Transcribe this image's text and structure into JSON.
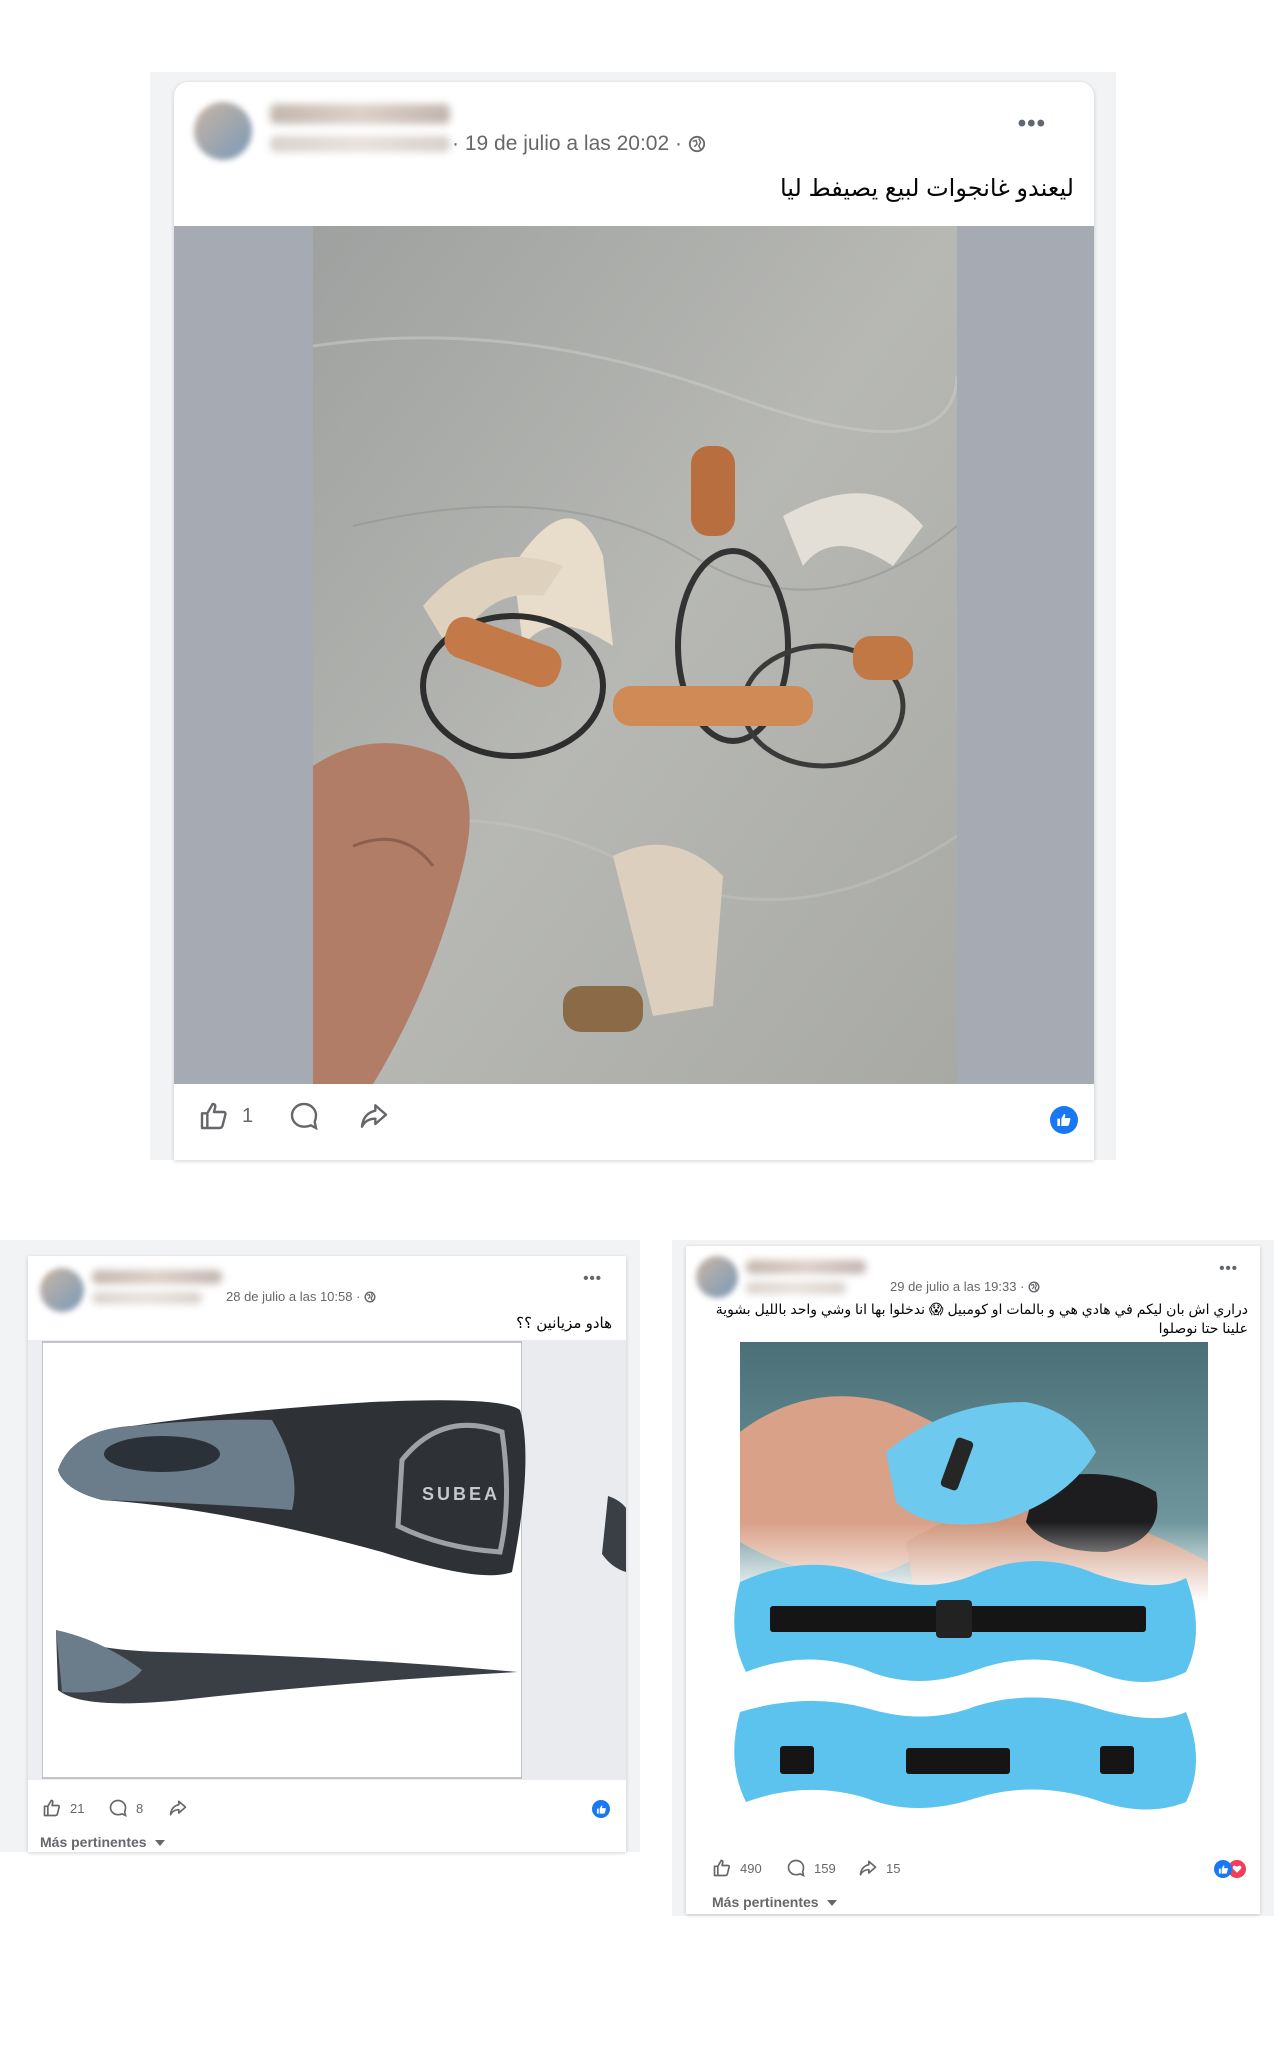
{
  "posts": [
    {
      "date": "19 de julio a las 20:02",
      "text": "ليعندو غانجوات لبيع يصيفط ليا",
      "likes": "1",
      "image_icon": "wooden-handles-with-cords-photo"
    },
    {
      "date": "28 de julio a las 10:58",
      "text": "هادو مزيانين ؟؟",
      "likes": "21",
      "comments": "8",
      "brand_on_fin": "SUBEA",
      "image_icon": "swim-fins-photo",
      "more_label": "Más pertinentes"
    },
    {
      "date": "29 de julio a las 19:33",
      "text": "دراري اش بان ليكم في هادي هي و بالمات او كومبيل 😱 ندخلوا بها انا وشي واحد بالليل بشوية علينا حتا نوصلوا",
      "likes": "490",
      "comments": "159",
      "shares": "15",
      "image_icon": "swim-belt-photo",
      "more_label": "Más pertinentes"
    }
  ],
  "colors": {
    "facebook_blue": "#1877f2",
    "reaction_red": "#f33e58",
    "meta_gray": "#65676b",
    "foam_blue": "#5cc3ef"
  }
}
